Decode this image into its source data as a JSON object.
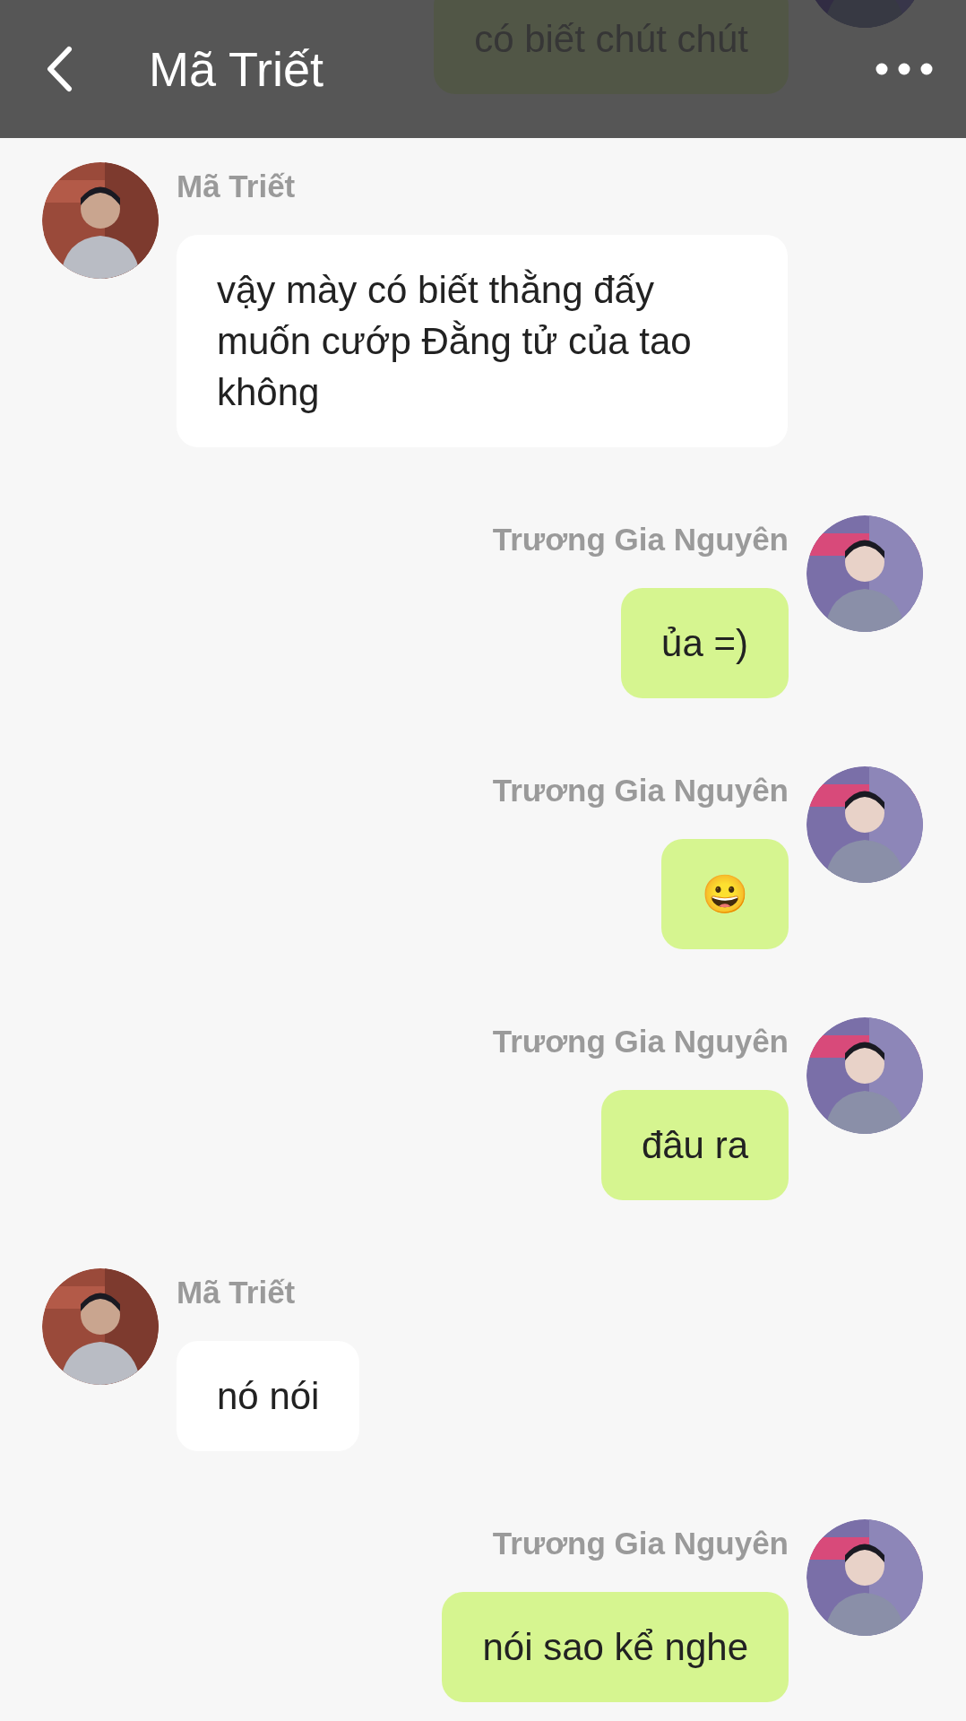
{
  "header": {
    "title": "Mã Triết"
  },
  "messages": [
    {
      "kind": "sent",
      "text": "có biết chút chút"
    },
    {
      "kind": "received",
      "name": "Mã Triết",
      "text": "vậy mày có biết thằng đấy muốn cướp Đằng tử của tao không"
    },
    {
      "kind": "sent",
      "name": "Trương Gia Nguyên",
      "text": "ủa =)"
    },
    {
      "kind": "sent",
      "name": "Trương Gia Nguyên",
      "text": "😀"
    },
    {
      "kind": "sent",
      "name": "Trương Gia Nguyên",
      "text": "đâu ra"
    },
    {
      "kind": "received",
      "name": "Mã Triết",
      "text": "nó nói"
    },
    {
      "kind": "sent",
      "name": "Trương Gia Nguyên",
      "text": "nói sao kể nghe"
    }
  ]
}
